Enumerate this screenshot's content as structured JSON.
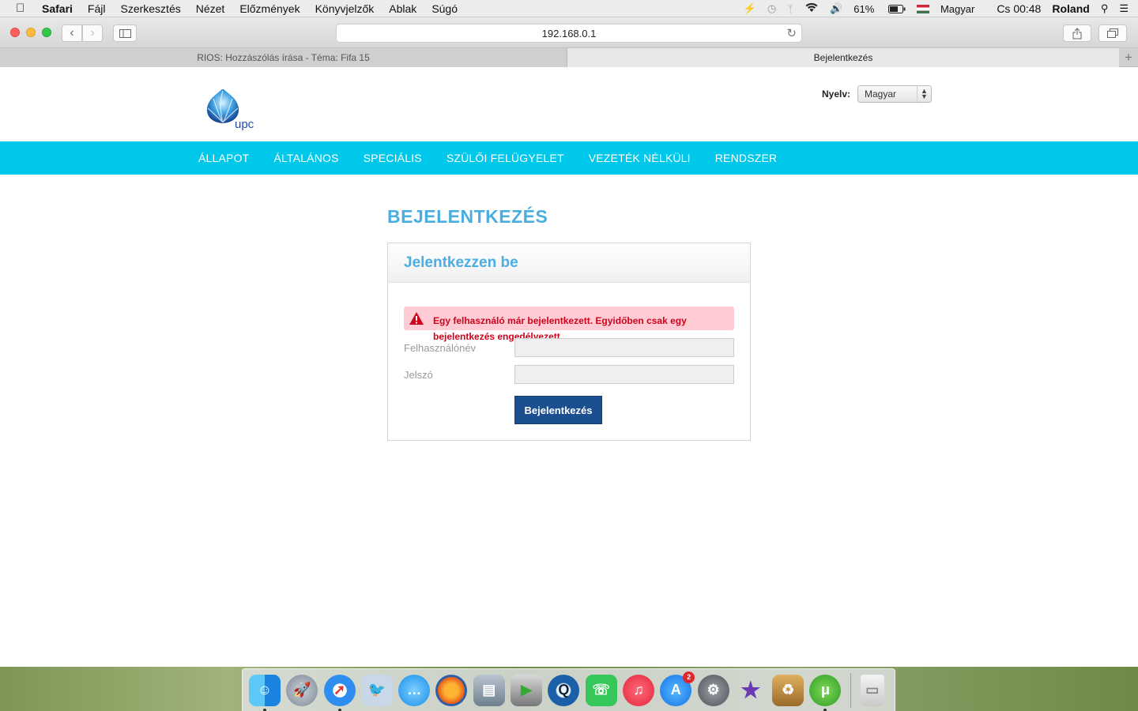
{
  "menubar": {
    "app": "Safari",
    "items": [
      "Fájl",
      "Szerkesztés",
      "Nézet",
      "Előzmények",
      "Könyvjelzők",
      "Ablak",
      "Súgó"
    ],
    "battery": "61%",
    "input_source": "Magyar",
    "clock": "Cs 00:48",
    "user": "Roland"
  },
  "browser": {
    "url": "192.168.0.1",
    "tabs": [
      {
        "label": "RIOS: Hozzászólás írása - Téma: Fifa 15"
      },
      {
        "label": "Bejelentkezés"
      }
    ]
  },
  "page": {
    "logo_text": "upc",
    "language_label": "Nyelv:",
    "language_value": "Magyar",
    "nav": [
      "ÁLLAPOT",
      "ÁLTALÁNOS",
      "SPECIÁLIS",
      "SZÜLŐI FELÜGYELET",
      "VEZETÉK NÉLKÜLI",
      "RENDSZER"
    ],
    "title": "BEJELENTKEZÉS",
    "box_title": "Jelentkezzen be",
    "error": "Egy felhasználó már bejelentkezett. Egyidőben csak egy bejelentkezés engedélyezett.",
    "username_label": "Felhasználónév",
    "password_label": "Jelszó",
    "username_value": "",
    "password_value": "",
    "login_button": "Bejelentkezés"
  },
  "dock": {
    "app_store_badge": "2"
  },
  "colors": {
    "nav_bg": "#00c8ea",
    "title": "#4aaee0",
    "button": "#1b4f8f",
    "error_bg": "#ffccd6",
    "error_text": "#d0021b"
  }
}
